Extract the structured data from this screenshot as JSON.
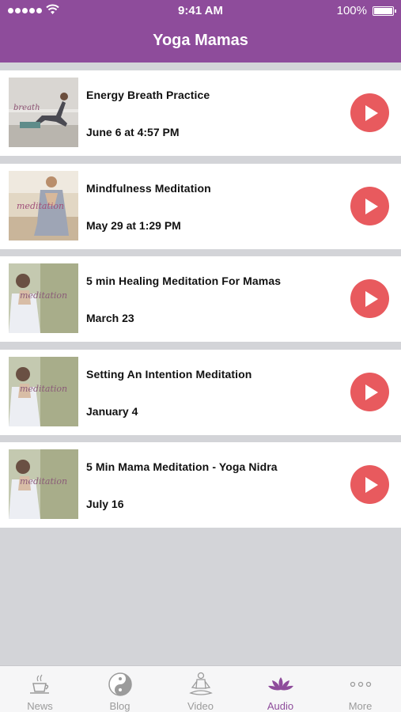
{
  "status": {
    "time": "9:41 AM",
    "battery": "100%"
  },
  "app": {
    "title": "Yoga Mamas"
  },
  "items": [
    {
      "title": "Energy Breath Practice",
      "date": "June 6 at 4:57 PM",
      "thumb_word": "breath"
    },
    {
      "title": "Mindfulness Meditation",
      "date": "May 29 at 1:29 PM",
      "thumb_word": "meditation"
    },
    {
      "title": "5 min Healing Meditation For Mamas",
      "date": "March 23",
      "thumb_word": "meditation"
    },
    {
      "title": "Setting An Intention Meditation",
      "date": "January 4",
      "thumb_word": "meditation"
    },
    {
      "title": "5 Min Mama Meditation - Yoga Nidra",
      "date": "July 16",
      "thumb_word": "meditation"
    }
  ],
  "tabs": [
    {
      "label": "News",
      "icon": "coffee-cup-icon"
    },
    {
      "label": "Blog",
      "icon": "yin-yang-icon"
    },
    {
      "label": "Video",
      "icon": "meditating-figure-icon"
    },
    {
      "label": "Audio",
      "icon": "lotus-icon",
      "active": true
    },
    {
      "label": "More",
      "icon": "more-dots-icon"
    }
  ],
  "colors": {
    "brand": "#8e4c9b",
    "play": "#e85a5e",
    "background": "#d3d4d8"
  }
}
